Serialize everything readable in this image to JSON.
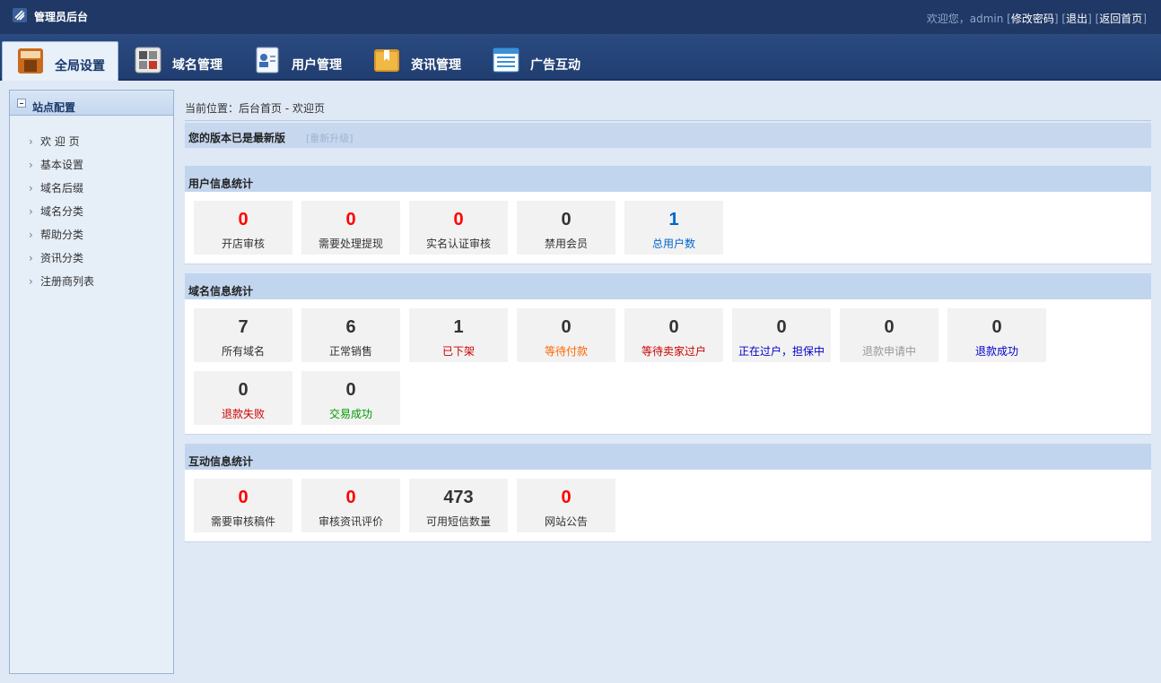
{
  "header": {
    "app_title": "管理员后台",
    "welcome": "欢迎您，admin",
    "links": [
      "修改密码",
      "退出",
      "返回首页"
    ]
  },
  "nav_tabs": [
    {
      "label": "全局设置",
      "icon": "settings-box-icon",
      "active": true
    },
    {
      "label": "域名管理",
      "icon": "grid-icon",
      "active": false
    },
    {
      "label": "用户管理",
      "icon": "user-card-icon",
      "active": false
    },
    {
      "label": "资讯管理",
      "icon": "folder-bookmark-icon",
      "active": false
    },
    {
      "label": "广告互动",
      "icon": "list-window-icon",
      "active": false
    }
  ],
  "sidebar": {
    "title": "站点配置",
    "items": [
      "欢 迎 页",
      "基本设置",
      "域名后缀",
      "域名分类",
      "帮助分类",
      "资讯分类",
      "注册商列表"
    ]
  },
  "main": {
    "breadcrumb": "当前位置：后台首页 - 欢迎页",
    "version_text": "您的版本已是最新版",
    "upgrade_link": "[重新升级]"
  },
  "colors": {
    "red": "#ff0000",
    "dark": "#333333",
    "blue": "#0066cc",
    "orange": "#ff6600",
    "crimson": "#cc0000",
    "navy": "#0000cc",
    "gray": "#999999",
    "green": "#009900"
  },
  "user_stats": {
    "title": "用户信息统计",
    "items": [
      {
        "value": "0",
        "label": "开店审核",
        "num_color": "red",
        "label_color": "dark"
      },
      {
        "value": "0",
        "label": "需要处理提现",
        "num_color": "red",
        "label_color": "dark"
      },
      {
        "value": "0",
        "label": "实名认证审核",
        "num_color": "red",
        "label_color": "dark"
      },
      {
        "value": "0",
        "label": "禁用会员",
        "num_color": "dark",
        "label_color": "dark"
      },
      {
        "value": "1",
        "label": "总用户数",
        "num_color": "blue",
        "label_color": "blue"
      }
    ]
  },
  "domain_stats": {
    "title": "域名信息统计",
    "items": [
      {
        "value": "7",
        "label": "所有域名",
        "num_color": "dark",
        "label_color": "dark"
      },
      {
        "value": "6",
        "label": "正常销售",
        "num_color": "dark",
        "label_color": "dark"
      },
      {
        "value": "1",
        "label": "已下架",
        "num_color": "dark",
        "label_color": "crimson"
      },
      {
        "value": "0",
        "label": "等待付款",
        "num_color": "dark",
        "label_color": "orange"
      },
      {
        "value": "0",
        "label": "等待卖家过户",
        "num_color": "dark",
        "label_color": "crimson"
      },
      {
        "value": "0",
        "label": "正在过户，担保中",
        "num_color": "dark",
        "label_color": "navy"
      },
      {
        "value": "0",
        "label": "退款申请中",
        "num_color": "dark",
        "label_color": "gray"
      },
      {
        "value": "0",
        "label": "退款成功",
        "num_color": "dark",
        "label_color": "navy"
      },
      {
        "value": "0",
        "label": "退款失败",
        "num_color": "dark",
        "label_color": "crimson"
      },
      {
        "value": "0",
        "label": "交易成功",
        "num_color": "dark",
        "label_color": "green"
      }
    ]
  },
  "interaction_stats": {
    "title": "互动信息统计",
    "items": [
      {
        "value": "0",
        "label": "需要审核稿件",
        "num_color": "red",
        "label_color": "dark"
      },
      {
        "value": "0",
        "label": "审核资讯评价",
        "num_color": "red",
        "label_color": "dark"
      },
      {
        "value": "473",
        "label": "可用短信数量",
        "num_color": "dark",
        "label_color": "dark"
      },
      {
        "value": "0",
        "label": "网站公告",
        "num_color": "red",
        "label_color": "dark"
      }
    ]
  }
}
